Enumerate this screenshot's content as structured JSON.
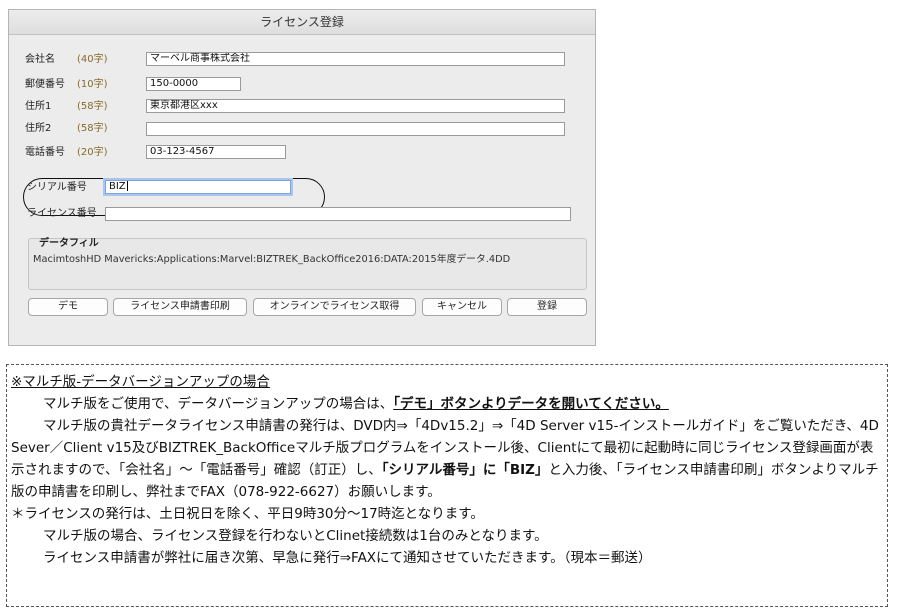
{
  "window": {
    "title": "ライセンス登録",
    "fields": [
      {
        "label": "会社名",
        "limit": "(40字)",
        "value": "マーベル商事株式会社"
      },
      {
        "label": "郵便番号",
        "limit": "(10字)",
        "value": "150-0000"
      },
      {
        "label": "住所1",
        "limit": "(58字)",
        "value": "東京都港区xxx"
      },
      {
        "label": "住所2",
        "limit": "(58字)",
        "value": ""
      },
      {
        "label": "電話番号",
        "limit": "(20字)",
        "value": "03-123-4567"
      }
    ],
    "serial": {
      "label": "シリアル番号",
      "value": "BIZ"
    },
    "license": {
      "label": "ライセンス番号",
      "value": ""
    },
    "datafile": {
      "label": "データフィル",
      "path": "MacimtoshHD Mavericks:Applications:Marvel:BIZTREK_BackOffice2016:DATA:2015年度データ.4DD"
    },
    "buttons": {
      "demo": "デモ",
      "print": "ライセンス申請書印刷",
      "online": "オンラインでライセンス取得",
      "cancel": "キャンセル",
      "register": "登録"
    }
  },
  "note": {
    "heading": "※マルチ版-データバージョンアップの場合",
    "p1_text": "マルチ版をご使用で、データバージョンアップの場合は、",
    "p1_emph": "「デモ」ボタンよりデータを開いてください。",
    "p2_a": "マルチ版の貴社データライセンス申請書の発行は、DVD内⇒「4Dv15.2」⇒「4D Server v15-インストールガイド」をご覧いただき、4D Sever／Client v15及びBIZTREK_BackOfficeマルチ版プログラムをインストール後、Clientにて最初に起動時に同じライセンス登録画面が表示されますので、「会社名」～「電話番号」確認（訂正）し、",
    "p2_b": "「シリアル番号」に「BIZ」",
    "p2_c": "と入力後、「ライセンス申請書印刷」ボタンよりマルチ版の申請書を印刷し、弊社までFAX（078-922-6627）お願いします。",
    "p3": "＊ライセンスの発行は、土日祝日を除く、平日9時30分～17時迄となります。",
    "p4": "マルチ版の場合、ライセンス登録を行わないとClinet接続数は1台のみとなります。",
    "p5": "ライセンス申請書が弊社に届き次第、早急に発行⇒FAXにて通知させていただきます。（現本＝郵送）"
  }
}
